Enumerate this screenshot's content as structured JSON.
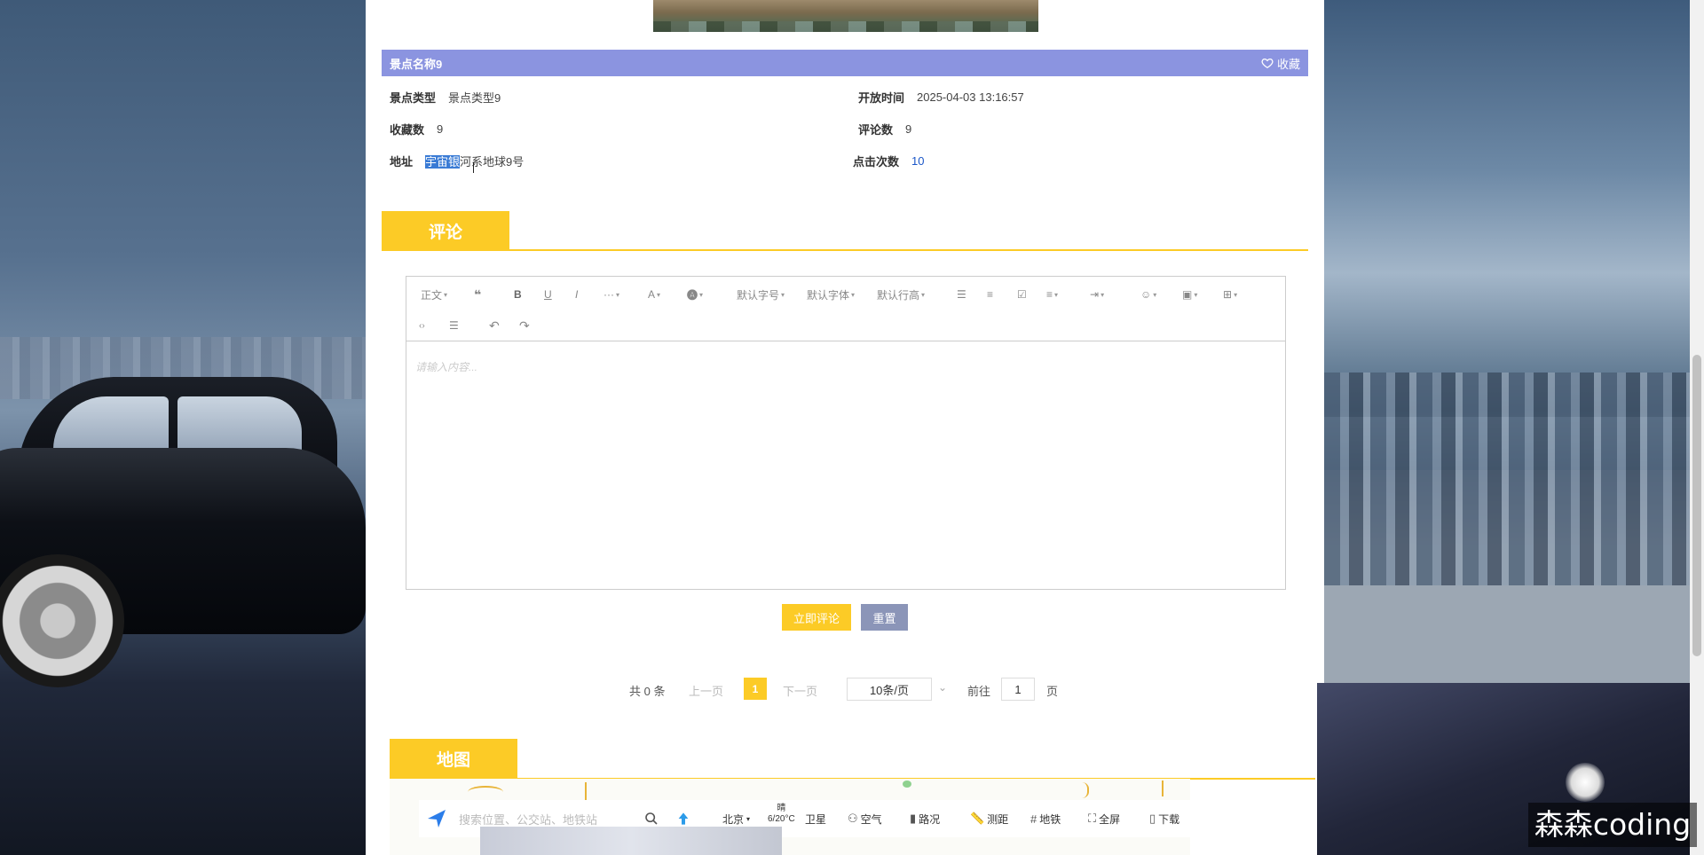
{
  "spot": {
    "name": "景点名称9",
    "favorite_label": "收藏",
    "type_label": "景点类型",
    "type_value": "景点类型9",
    "open_time_label": "开放时间",
    "open_time_value": "2025-04-03 13:16:57",
    "fav_count_label": "收藏数",
    "fav_count_value": "9",
    "comment_count_label": "评论数",
    "comment_count_value": "9",
    "address_label": "地址",
    "address_selected": "宇宙银",
    "address_rest": "河系地球9号",
    "click_count_label": "点击次数",
    "click_count_value": "10"
  },
  "comments_section": {
    "title": "评论"
  },
  "editor": {
    "toolbar": {
      "paragraph": "正文",
      "font_size": "默认字号",
      "font_family": "默认字体",
      "line_height": "默认行高"
    },
    "placeholder": "请输入内容..."
  },
  "actions": {
    "submit_label": "立即评论",
    "reset_label": "重置"
  },
  "pagination": {
    "total": "共 0 条",
    "prev": "上一页",
    "current": "1",
    "next": "下一页",
    "page_size": "10条/页",
    "goto_label": "前往",
    "goto_value": "1",
    "page_suffix": "页"
  },
  "map_section": {
    "title": "地图",
    "search_placeholder": "搜索位置、公交站、地铁站",
    "city": "北京",
    "weather": "晴",
    "temperature": "6/20°C",
    "satellite": "卫星",
    "air": "空气",
    "traffic": "路况",
    "measure": "测距",
    "subway": "地铁",
    "fullscreen": "全屏",
    "download": "下载"
  },
  "watermark": "森森coding",
  "colors": {
    "title_bar": "#8b94e0",
    "accent_yellow": "#fccb26",
    "reset_button": "#8b95b8",
    "selection": "#3a7bd5"
  }
}
